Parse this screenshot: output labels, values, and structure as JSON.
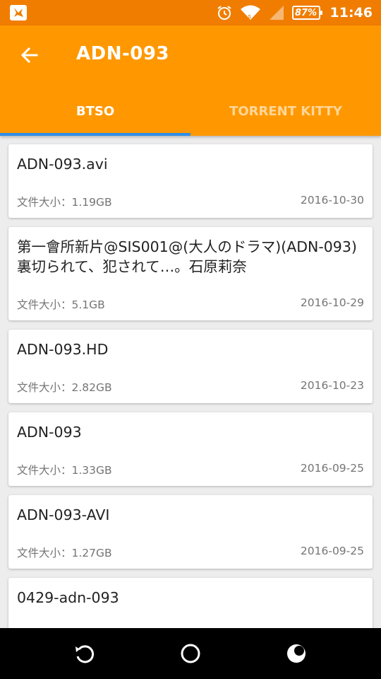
{
  "status_bar": {
    "battery": "87%",
    "time": "11:46",
    "icons": [
      "app-notification-icon",
      "alarm-icon",
      "wifi-icon",
      "signal-icon",
      "battery-icon"
    ]
  },
  "app_bar": {
    "title": "ADN-093",
    "tabs": [
      {
        "label": "BTSO",
        "active": true
      },
      {
        "label": "TORRENT KITTY",
        "active": false
      }
    ],
    "accent": "#ff9800",
    "indicator_color": "#2e8ee8"
  },
  "results": [
    {
      "name": "ADN-093.avi",
      "size": "文件大小：1.19GB",
      "date": "2016-10-30"
    },
    {
      "name": "第一會所新片@SIS001@(大人のドラマ)(ADN-093)裏切られて、犯されて…。石原莉奈",
      "size": "文件大小：5.1GB",
      "date": "2016-10-29"
    },
    {
      "name": "ADN-093.HD",
      "size": "文件大小：2.82GB",
      "date": "2016-10-23"
    },
    {
      "name": "ADN-093",
      "size": "文件大小：1.33GB",
      "date": "2016-09-25"
    },
    {
      "name": "ADN-093-AVI",
      "size": "文件大小：1.27GB",
      "date": "2016-09-25"
    },
    {
      "name": "0429-adn-093",
      "size": "",
      "date": ""
    }
  ],
  "nav_bar": {
    "icons": [
      "back-icon",
      "home-icon",
      "recents-icon"
    ]
  }
}
